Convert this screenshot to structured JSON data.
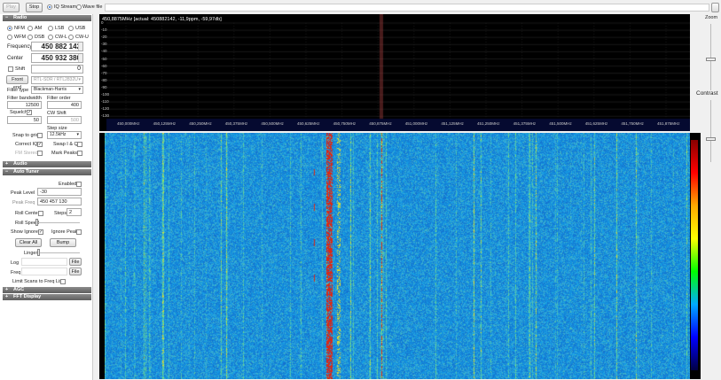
{
  "toolbar": {
    "play": "Play",
    "stop": "Stop",
    "iq_stream": "IQ Stream",
    "wave_file": "Wave file",
    "source_path": ""
  },
  "radio": {
    "header": "Radio",
    "modes": [
      "NFM",
      "AM",
      "LSB",
      "USB",
      "WFM",
      "DSB",
      "CW-L",
      "CW-U"
    ],
    "selected_mode": "NFM",
    "frequency_label": "Frequency",
    "frequency": "450 882 142",
    "center_label": "Center",
    "center": "450 932 380",
    "shift_label": "Shift",
    "shift": "0",
    "front_end_button": "Front end",
    "front_end": "RTL-SDR / RTL2832U",
    "filter_type_label": "Filter type",
    "filter_type": "Blackman-Harris",
    "filter_bandwidth_label": "Filter bandwidth",
    "filter_bandwidth": "12500",
    "filter_order_label": "Filter order",
    "filter_order": "400",
    "squelch_label": "Squelch",
    "squelch": "50",
    "cw_shift_label": "CW Shift",
    "cw_shift": "500",
    "step_size_label": "Step size",
    "step_size": "12.5kHz",
    "snap_label": "Snap to grid",
    "correct_iq_label": "Correct IQ",
    "swap_iq_label": "Swap I & Q",
    "fm_stereo_label": "FM Stereo",
    "mark_peaks_label": "Mark Peaks"
  },
  "audio": {
    "header": "Audio"
  },
  "auto_tuner": {
    "header": "Auto Tuner",
    "enabled_label": "Enabled",
    "peak_level_label": "Peak Level",
    "peak_level": "-30",
    "peak_freq_label": "Peak Freq",
    "peak_freq": "450 457 130",
    "roll_center_label": "Roll Center",
    "steps_label": "Steps",
    "steps": "2",
    "roll_speed_label": "Roll Speed",
    "show_ignored_label": "Show Ignored",
    "ignore_peak_label": "Ignore Peak",
    "clear_all": "Clear All",
    "bump": "Bump",
    "linger_label": "Linger",
    "log_label": "Log",
    "freq_label": "Freq",
    "file_button": "File",
    "limit_label": "Limit Scans to Freq List"
  },
  "agc": {
    "header": "AGC"
  },
  "fft_display": {
    "header": "FFT Display"
  },
  "spectrum": {
    "readout": "450,8875MHz  [actual: 450882142, -11,9ppm, -59,97db]",
    "db_ticks": [
      "0",
      "-10",
      "-20",
      "-30",
      "-40",
      "-50",
      "-60",
      "-70",
      "-80",
      "-90",
      "-100",
      "-110",
      "-120",
      "-130"
    ],
    "freq_ticks": [
      "450,000MHz",
      "450,125MHz",
      "450,250MHz",
      "450,375MHz",
      "450,500MHz",
      "450,625MHz",
      "450,750MHz",
      "450,875MHz",
      "451,000MHz",
      "451,125MHz",
      "451,250MHz",
      "451,375MHz",
      "451,500MHz",
      "451,625MHz",
      "451,750MHz",
      "451,875MHz"
    ]
  },
  "right_panel": {
    "zoom_label": "Zoom",
    "contrast_label": "Contrast",
    "zoom_level": 0.75,
    "contrast_level": 0.4
  },
  "colors": {
    "background": "#000000",
    "spectrum_fill": "#1e5cb3",
    "marker": "#8b3a3a",
    "header": "#6b6b6b"
  }
}
